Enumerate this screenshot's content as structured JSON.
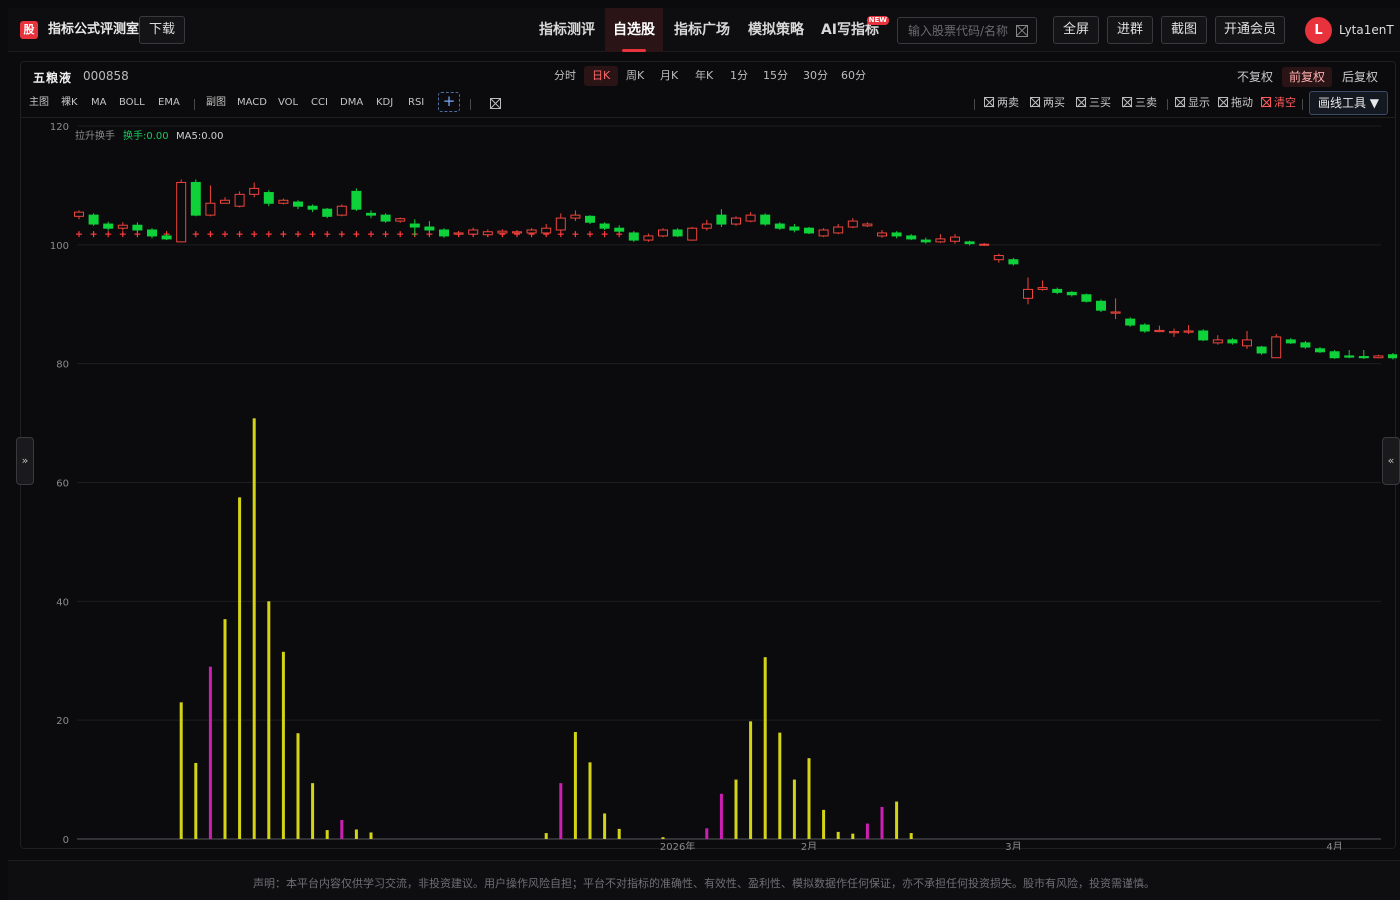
{
  "header": {
    "logo_glyph": "股",
    "app_title": "指标公式评测室",
    "download_label": "下载",
    "nav": [
      {
        "label": "指标测评",
        "active": false
      },
      {
        "label": "自选股",
        "active": true
      },
      {
        "label": "指标广场",
        "active": false
      },
      {
        "label": "模拟策略",
        "active": false
      },
      {
        "label": "AI写指标",
        "active": false,
        "badge": "NEW"
      }
    ],
    "search_placeholder": "输入股票代码/名称",
    "buttons": {
      "fullscreen": "全屏",
      "join_group": "进群",
      "screenshot": "截图",
      "vip": "开通会员"
    },
    "avatar_letter": "L",
    "username": "Lyta1enT"
  },
  "stock": {
    "name": "五粮液",
    "code": "000858"
  },
  "periods": [
    {
      "label": "分时",
      "active": false
    },
    {
      "label": "日K",
      "active": true
    },
    {
      "label": "周K",
      "active": false
    },
    {
      "label": "月K",
      "active": false
    },
    {
      "label": "年K",
      "active": false
    },
    {
      "label": "1分",
      "active": false
    },
    {
      "label": "15分",
      "active": false
    },
    {
      "label": "30分",
      "active": false
    },
    {
      "label": "60分",
      "active": false
    }
  ],
  "adjust": [
    {
      "label": "不复权",
      "active": false
    },
    {
      "label": "前复权",
      "active": true
    },
    {
      "label": "后复权",
      "active": false
    }
  ],
  "indicators": {
    "main_label": "主图",
    "main": [
      "裸K",
      "MA",
      "BOLL",
      "EMA"
    ],
    "sub_label": "副图",
    "sub": [
      "MACD",
      "VOL",
      "CCI",
      "DMA",
      "KDJ",
      "RSI"
    ],
    "add_label": "+"
  },
  "tools": {
    "items": [
      "两卖",
      "两买",
      "三买",
      "三卖"
    ],
    "show": "显示",
    "drag": "拖动",
    "clear": "清空",
    "draw_tools": "画线工具 ▼"
  },
  "legend": {
    "title": "拉升换手",
    "turnover": "换手:0.00",
    "ma5": "MA5:0.00"
  },
  "side_tabs": {
    "left": "»",
    "right": "«"
  },
  "colors": {
    "up": "#f0443c",
    "down": "#0fd13a",
    "vol_yellow": "#d4d416",
    "vol_magenta": "#cc1fb4",
    "marker": "#ff3b3b"
  },
  "chart_data": {
    "type": "candlestick",
    "ylim": [
      0,
      120
    ],
    "yticks": [
      0,
      20,
      40,
      60,
      80,
      100,
      120
    ],
    "xticks": [
      "2026年",
      "2月",
      "3月",
      "4月"
    ],
    "xtick_index": [
      41,
      50,
      64,
      86
    ],
    "candles": [
      [
        104.8,
        105.5,
        105.8,
        104.3
      ],
      [
        105.0,
        103.5,
        105.3,
        103.2
      ],
      [
        103.5,
        102.8,
        103.9,
        102.4
      ],
      [
        102.8,
        103.3,
        103.8,
        102.4
      ],
      [
        103.3,
        102.5,
        103.8,
        102.1
      ],
      [
        102.5,
        101.5,
        102.8,
        101.1
      ],
      [
        101.5,
        101.0,
        101.8,
        100.8
      ],
      [
        100.5,
        110.5,
        111.0,
        100.5
      ],
      [
        110.5,
        105.0,
        111.0,
        104.8
      ],
      [
        105.0,
        107.0,
        110.0,
        104.8
      ],
      [
        107.0,
        107.5,
        108.0,
        107.0
      ],
      [
        106.5,
        108.5,
        109.0,
        106.3
      ],
      [
        108.5,
        109.5,
        110.5,
        108.0
      ],
      [
        108.8,
        107.0,
        109.2,
        106.5
      ],
      [
        107.0,
        107.5,
        107.8,
        106.8
      ],
      [
        107.2,
        106.5,
        107.5,
        106.0
      ],
      [
        106.5,
        106.0,
        106.8,
        105.5
      ],
      [
        106.0,
        104.8,
        106.2,
        104.5
      ],
      [
        105.0,
        106.5,
        106.8,
        104.8
      ],
      [
        109.0,
        106.0,
        109.5,
        105.7
      ],
      [
        105.3,
        105.0,
        105.8,
        104.5
      ],
      [
        105.0,
        104.0,
        105.3,
        103.7
      ],
      [
        104.0,
        104.4,
        104.6,
        103.7
      ],
      [
        103.5,
        103.0,
        104.3,
        101.5
      ],
      [
        103.0,
        102.5,
        104.0,
        102.1
      ],
      [
        102.5,
        101.5,
        102.8,
        101.2
      ],
      [
        101.8,
        102.0,
        102.3,
        101.5
      ],
      [
        101.8,
        102.5,
        102.9,
        101.5
      ],
      [
        101.7,
        102.2,
        102.6,
        101.4
      ],
      [
        102.0,
        102.3,
        102.6,
        101.8
      ],
      [
        102.0,
        102.2,
        102.5,
        101.9
      ],
      [
        102.0,
        102.5,
        102.8,
        101.8
      ],
      [
        102.0,
        102.8,
        103.5,
        101.8
      ],
      [
        102.5,
        104.5,
        105.3,
        102.3
      ],
      [
        104.5,
        105.0,
        105.8,
        104.0
      ],
      [
        104.8,
        103.8,
        105.0,
        103.5
      ],
      [
        103.5,
        102.8,
        103.8,
        102.5
      ],
      [
        102.8,
        102.3,
        103.3,
        102.0
      ],
      [
        102.0,
        100.8,
        102.2,
        100.5
      ],
      [
        100.8,
        101.5,
        101.9,
        100.5
      ],
      [
        101.5,
        102.5,
        102.8,
        101.3
      ],
      [
        102.5,
        101.5,
        102.8,
        101.3
      ],
      [
        100.8,
        102.8,
        103.0,
        100.7
      ],
      [
        102.8,
        103.5,
        104.2,
        102.4
      ],
      [
        105.0,
        103.5,
        106.0,
        103.0
      ],
      [
        103.5,
        104.5,
        104.8,
        103.2
      ],
      [
        104.0,
        105.0,
        105.5,
        103.8
      ],
      [
        105.0,
        103.5,
        105.3,
        103.2
      ],
      [
        103.5,
        102.8,
        103.8,
        102.5
      ],
      [
        103.0,
        102.5,
        103.5,
        102.1
      ],
      [
        102.8,
        102.0,
        103.0,
        101.8
      ],
      [
        101.5,
        102.5,
        102.8,
        101.3
      ],
      [
        102.0,
        103.0,
        103.5,
        101.8
      ],
      [
        103.0,
        104.0,
        104.5,
        102.8
      ],
      [
        103.2,
        103.5,
        103.8,
        103.0
      ],
      [
        101.5,
        102.0,
        102.5,
        101.2
      ],
      [
        102.0,
        101.5,
        102.3,
        101.1
      ],
      [
        101.5,
        101.0,
        101.8,
        100.8
      ],
      [
        100.8,
        100.5,
        101.2,
        100.2
      ],
      [
        100.5,
        101.0,
        101.8,
        100.3
      ],
      [
        100.6,
        101.3,
        101.8,
        100.2
      ],
      [
        100.5,
        100.2,
        100.7,
        99.9
      ],
      [
        100.0,
        100.1,
        100.3,
        99.8
      ],
      [
        97.5,
        98.2,
        98.5,
        97.0
      ],
      [
        97.5,
        96.8,
        97.8,
        96.5
      ],
      [
        91.0,
        92.5,
        94.5,
        90.0
      ],
      [
        92.5,
        92.8,
        94.0,
        92.3
      ],
      [
        92.5,
        92.0,
        92.8,
        91.7
      ],
      [
        92.0,
        91.6,
        92.2,
        91.3
      ],
      [
        91.6,
        90.5,
        91.8,
        90.3
      ],
      [
        90.5,
        89.0,
        90.8,
        88.7
      ],
      [
        88.5,
        88.7,
        91.0,
        87.5
      ],
      [
        87.5,
        86.5,
        87.8,
        86.2
      ],
      [
        86.5,
        85.5,
        86.8,
        85.2
      ],
      [
        85.4,
        85.6,
        86.4,
        85.3
      ],
      [
        85.2,
        85.4,
        85.9,
        84.5
      ],
      [
        85.3,
        85.5,
        86.5,
        85.0
      ],
      [
        85.5,
        84.0,
        85.8,
        83.8
      ],
      [
        83.5,
        84.0,
        84.8,
        83.2
      ],
      [
        84.0,
        83.5,
        84.3,
        83.2
      ],
      [
        83.0,
        84.0,
        85.5,
        82.5
      ],
      [
        82.8,
        81.8,
        83.0,
        81.5
      ],
      [
        81.0,
        84.5,
        85.0,
        81.0
      ],
      [
        84.0,
        83.5,
        84.3,
        83.3
      ],
      [
        83.5,
        82.8,
        83.8,
        82.5
      ],
      [
        82.5,
        82.0,
        82.8,
        81.8
      ],
      [
        82.0,
        81.0,
        82.3,
        80.8
      ],
      [
        81.3,
        81.1,
        82.3,
        80.9
      ],
      [
        81.2,
        81.0,
        82.3,
        80.8
      ],
      [
        81.0,
        81.3,
        81.5,
        80.9
      ],
      [
        81.5,
        81.0,
        81.8,
        80.7
      ]
    ],
    "markers_value": 101.8,
    "marker_range": [
      0,
      38
    ],
    "volume": [
      [
        7,
        23.0,
        "y"
      ],
      [
        8,
        12.8,
        "y"
      ],
      [
        9,
        29.0,
        "m"
      ],
      [
        10,
        37.0,
        "y"
      ],
      [
        11,
        57.5,
        "y"
      ],
      [
        12,
        70.8,
        "y"
      ],
      [
        13,
        40.0,
        "y"
      ],
      [
        14,
        31.5,
        "y"
      ],
      [
        15,
        17.8,
        "y"
      ],
      [
        16,
        9.4,
        "y"
      ],
      [
        17,
        1.5,
        "y"
      ],
      [
        18,
        3.2,
        "m"
      ],
      [
        19,
        1.6,
        "y"
      ],
      [
        20,
        1.1,
        "y"
      ],
      [
        32,
        1.0,
        "y"
      ],
      [
        33,
        9.4,
        "m"
      ],
      [
        34,
        18.0,
        "y"
      ],
      [
        35,
        12.9,
        "y"
      ],
      [
        36,
        4.3,
        "y"
      ],
      [
        37,
        1.7,
        "y"
      ],
      [
        40,
        0.3,
        "y"
      ],
      [
        43,
        1.8,
        "m"
      ],
      [
        44,
        7.6,
        "m"
      ],
      [
        45,
        10.0,
        "y"
      ],
      [
        46,
        19.8,
        "y"
      ],
      [
        47,
        30.6,
        "y"
      ],
      [
        48,
        17.9,
        "y"
      ],
      [
        49,
        10.0,
        "y"
      ],
      [
        50,
        13.6,
        "y"
      ],
      [
        51,
        4.9,
        "y"
      ],
      [
        52,
        1.2,
        "y"
      ],
      [
        53,
        0.9,
        "y"
      ],
      [
        54,
        2.6,
        "m"
      ],
      [
        55,
        5.4,
        "m"
      ],
      [
        56,
        6.3,
        "y"
      ],
      [
        57,
        1.0,
        "y"
      ]
    ]
  }
}
